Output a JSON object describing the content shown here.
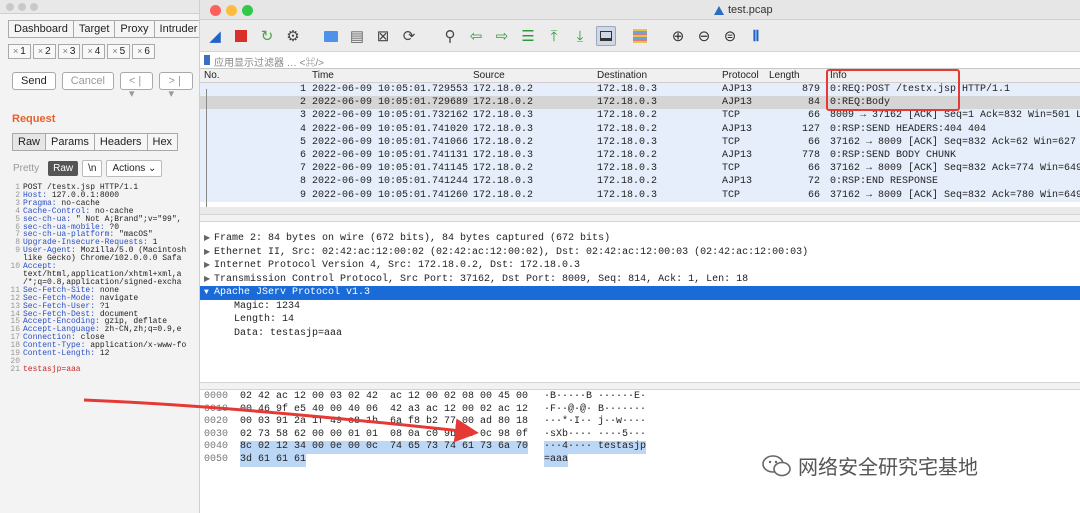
{
  "burp": {
    "tabs": [
      "Dashboard",
      "Target",
      "Proxy",
      "Intruder"
    ],
    "numbered_tabs": [
      {
        "label": "1",
        "close": "×"
      },
      {
        "label": "2",
        "close": "×"
      },
      {
        "label": "3",
        "close": "×"
      },
      {
        "label": "4",
        "close": "×"
      },
      {
        "label": "5",
        "close": "×"
      },
      {
        "label": "6",
        "close": "×"
      }
    ],
    "send_label": "Send",
    "cancel_label": "Cancel",
    "back_label": "< |▾",
    "forward_label": "> |▾",
    "request_title": "Request",
    "subtabs": [
      "Raw",
      "Params",
      "Headers",
      "Hex"
    ],
    "view_modes": {
      "pretty": "Pretty",
      "raw": "Raw",
      "newline": "\\n",
      "actions": "Actions ⌄"
    },
    "request_lines": [
      {
        "n": "1",
        "key": "",
        "val": "POST /testx.jsp HTTP/1.1"
      },
      {
        "n": "2",
        "key": "Host:",
        "val": " 127.0.0.1:8000"
      },
      {
        "n": "3",
        "key": "Pragma:",
        "val": " no-cache"
      },
      {
        "n": "4",
        "key": "Cache-Control:",
        "val": " no-cache"
      },
      {
        "n": "5",
        "key": "sec-ch-ua:",
        "val": " \" Not A;Brand\";v=\"99\","
      },
      {
        "n": "6",
        "key": "sec-ch-ua-mobile:",
        "val": " ?0"
      },
      {
        "n": "7",
        "key": "sec-ch-ua-platform:",
        "val": " \"macOS\""
      },
      {
        "n": "8",
        "key": "Upgrade-Insecure-Requests:",
        "val": " 1"
      },
      {
        "n": "9",
        "key": "User-Agent:",
        "val": " Mozilla/5.0 (Macintosh"
      },
      {
        "n": "",
        "key": "",
        "val": "like Gecko) Chrome/102.0.0.0 Safa"
      },
      {
        "n": "10",
        "key": "Accept:",
        "val": ""
      },
      {
        "n": "",
        "key": "",
        "val": "text/html,application/xhtml+xml,a"
      },
      {
        "n": "",
        "key": "",
        "val": "/*;q=0.8,application/signed-excha"
      },
      {
        "n": "11",
        "key": "Sec-Fetch-Site:",
        "val": " none"
      },
      {
        "n": "12",
        "key": "Sec-Fetch-Mode:",
        "val": " navigate"
      },
      {
        "n": "13",
        "key": "Sec-Fetch-User:",
        "val": " ?1"
      },
      {
        "n": "14",
        "key": "Sec-Fetch-Dest:",
        "val": " document"
      },
      {
        "n": "15",
        "key": "Accept-Encoding:",
        "val": " gzip, deflate"
      },
      {
        "n": "16",
        "key": "Accept-Language:",
        "val": " zh-CN,zh;q=0.9,e"
      },
      {
        "n": "17",
        "key": "Connection:",
        "val": " close"
      },
      {
        "n": "18",
        "key": "Content-Type:",
        "val": " application/x-www-fo"
      },
      {
        "n": "19",
        "key": "Content-Length:",
        "val": " 12"
      },
      {
        "n": "20",
        "key": "",
        "val": ""
      },
      {
        "n": "21",
        "key": "",
        "val": "testasjp=aaa",
        "param": true
      }
    ]
  },
  "wireshark": {
    "title": "test.pcap",
    "filter_placeholder": "应用显示过滤器 … <⌘/>",
    "columns": {
      "no": "No.",
      "time": "Time",
      "source": "Source",
      "destination": "Destination",
      "protocol": "Protocol",
      "length": "Length",
      "info": "Info"
    },
    "packets": [
      {
        "no": "1",
        "time": "2022-06-09 10:05:01.729553",
        "src": "172.18.0.2",
        "dst": "172.18.0.3",
        "proto": "AJP13",
        "len": "879",
        "info": "0:REQ:POST /testx.jsp HTTP/1.1",
        "color": "#e6eefb"
      },
      {
        "no": "2",
        "time": "2022-06-09 10:05:01.729689",
        "src": "172.18.0.2",
        "dst": "172.18.0.3",
        "proto": "AJP13",
        "len": "84",
        "info": "0:REQ:Body",
        "color": "#d5d5d5"
      },
      {
        "no": "3",
        "time": "2022-06-09 10:05:01.732162",
        "src": "172.18.0.3",
        "dst": "172.18.0.2",
        "proto": "TCP",
        "len": "66",
        "info": "8009 → 37162 [ACK] Seq=1 Ack=832 Win=501 L",
        "color": "#e6eefb"
      },
      {
        "no": "4",
        "time": "2022-06-09 10:05:01.741020",
        "src": "172.18.0.3",
        "dst": "172.18.0.2",
        "proto": "AJP13",
        "len": "127",
        "info": "0:RSP:SEND HEADERS:404 404",
        "color": "#e6eefb"
      },
      {
        "no": "5",
        "time": "2022-06-09 10:05:01.741066",
        "src": "172.18.0.2",
        "dst": "172.18.0.3",
        "proto": "TCP",
        "len": "66",
        "info": "37162 → 8009 [ACK] Seq=832 Ack=62 Win=627",
        "color": "#e6eefb"
      },
      {
        "no": "6",
        "time": "2022-06-09 10:05:01.741131",
        "src": "172.18.0.3",
        "dst": "172.18.0.2",
        "proto": "AJP13",
        "len": "778",
        "info": "0:RSP:SEND BODY CHUNK",
        "color": "#e6eefb"
      },
      {
        "no": "7",
        "time": "2022-06-09 10:05:01.741145",
        "src": "172.18.0.2",
        "dst": "172.18.0.3",
        "proto": "TCP",
        "len": "66",
        "info": "37162 → 8009 [ACK] Seq=832 Ack=774 Win=649",
        "color": "#e6eefb"
      },
      {
        "no": "8",
        "time": "2022-06-09 10:05:01.741244",
        "src": "172.18.0.3",
        "dst": "172.18.0.2",
        "proto": "AJP13",
        "len": "72",
        "info": "0:RSP:END RESPONSE",
        "color": "#e6eefb"
      },
      {
        "no": "9",
        "time": "2022-06-09 10:05:01.741260",
        "src": "172.18.0.2",
        "dst": "172.18.0.3",
        "proto": "TCP",
        "len": "66",
        "info": "37162 → 8009 [ACK] Seq=832 Ack=780 Win=649",
        "color": "#e6eefb"
      }
    ],
    "details": [
      {
        "text": "Frame 2: 84 bytes on wire (672 bits), 84 bytes captured (672 bits)",
        "tri": "▶",
        "sel": false,
        "child": false
      },
      {
        "text": "Ethernet II, Src: 02:42:ac:12:00:02 (02:42:ac:12:00:02), Dst: 02:42:ac:12:00:03 (02:42:ac:12:00:03)",
        "tri": "▶",
        "sel": false,
        "child": false
      },
      {
        "text": "Internet Protocol Version 4, Src: 172.18.0.2, Dst: 172.18.0.3",
        "tri": "▶",
        "sel": false,
        "child": false
      },
      {
        "text": "Transmission Control Protocol, Src Port: 37162, Dst Port: 8009, Seq: 814, Ack: 1, Len: 18",
        "tri": "▶",
        "sel": false,
        "child": false
      },
      {
        "text": "Apache JServ Protocol v1.3",
        "tri": "▼",
        "sel": true,
        "child": false
      },
      {
        "text": "Magic: 1234",
        "tri": "",
        "sel": false,
        "child": true
      },
      {
        "text": "Length: 14",
        "tri": "",
        "sel": false,
        "child": true
      },
      {
        "text": "Data: testasjp=aaa",
        "tri": "",
        "sel": false,
        "child": true
      }
    ],
    "bytes": [
      {
        "off": "0000",
        "hex": "02 42 ac 12 00 03 02 42  ac 12 00 02 08 00 45 00",
        "asc": "·B·····B ······E·"
      },
      {
        "off": "0010",
        "hex": "00 46 9f e5 40 00 40 06  42 a3 ac 12 00 02 ac 12",
        "asc": "·F··@·@· B·······"
      },
      {
        "off": "0020",
        "hex": "00 03 91 2a 1f 49 e8 1b  6a f8 b2 77 00 ad 80 18",
        "asc": "···*·I·· j··w····"
      },
      {
        "off": "0030",
        "hex": "02 73 58 62 00 00 01 01  08 0a c0 9b 35 0c 98 0f",
        "asc": "·sXb···· ····5···"
      },
      {
        "off": "0040",
        "hex": "8c 02 12 34 00 0e 00 0c  74 65 73 74 61 73 6a 70",
        "asc": "···4···· testasjp"
      },
      {
        "off": "0050",
        "hex": "3d 61 61 61",
        "asc": "=aaa"
      }
    ]
  },
  "watermark": "网络安全研究宅基地",
  "colors": {
    "accent": "#1a6ad8",
    "highlight_box": "#e53935",
    "arrow": "#e53935",
    "burp_orange": "#e8622a"
  }
}
